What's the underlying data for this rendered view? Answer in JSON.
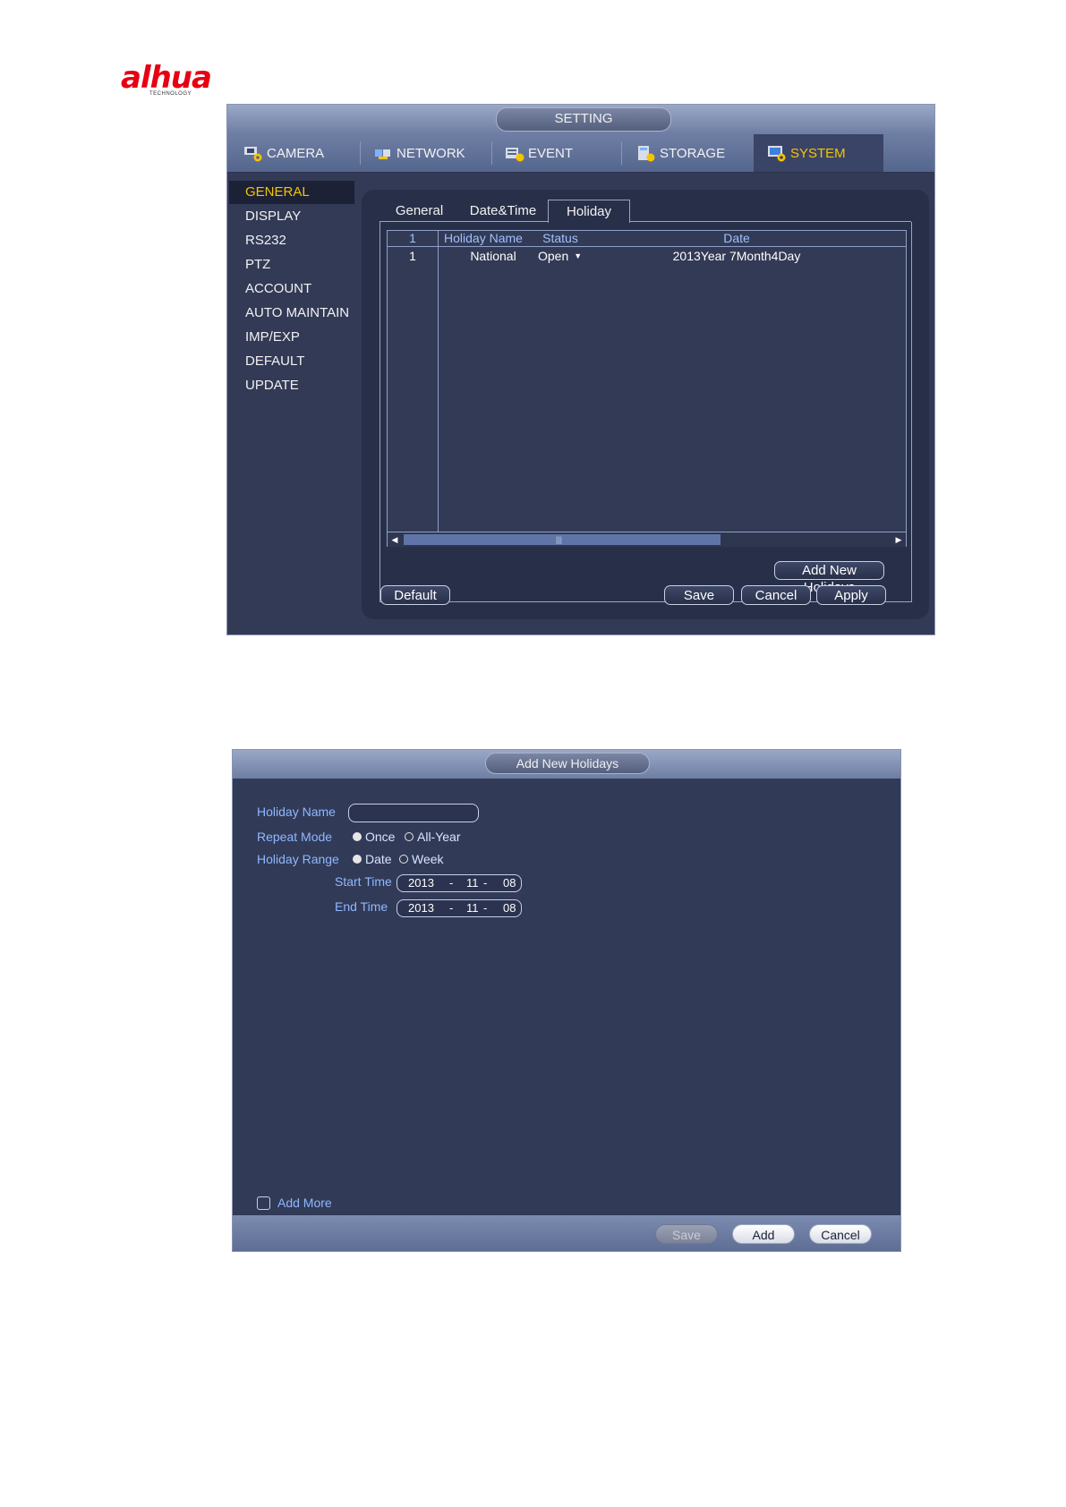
{
  "logo": {
    "text": "alhua",
    "subtext": "TECHNOLOGY"
  },
  "setting_window": {
    "title": "SETTING",
    "main_tabs": [
      {
        "label": "CAMERA",
        "icon": "camera-gear-icon"
      },
      {
        "label": "NETWORK",
        "icon": "network-icon"
      },
      {
        "label": "EVENT",
        "icon": "event-icon"
      },
      {
        "label": "STORAGE",
        "icon": "storage-icon"
      },
      {
        "label": "SYSTEM",
        "icon": "system-icon",
        "active": true
      }
    ],
    "sidebar": [
      {
        "label": "GENERAL",
        "active": true
      },
      {
        "label": "DISPLAY"
      },
      {
        "label": "RS232"
      },
      {
        "label": "PTZ"
      },
      {
        "label": "ACCOUNT"
      },
      {
        "label": "AUTO MAINTAIN"
      },
      {
        "label": "IMP/EXP"
      },
      {
        "label": "DEFAULT"
      },
      {
        "label": "UPDATE"
      }
    ],
    "sub_tabs": [
      {
        "label": "General"
      },
      {
        "label": "Date&Time"
      },
      {
        "label": "Holiday",
        "active": true
      }
    ],
    "table": {
      "headers": [
        "1",
        "Holiday Name",
        "Status",
        "Date"
      ],
      "rows": [
        {
          "index": "1",
          "name": "National",
          "status": "Open",
          "date": "2013Year 7Month4Day"
        }
      ]
    },
    "buttons": {
      "add_new_holidays": "Add New Holidays",
      "default": "Default",
      "save": "Save",
      "cancel": "Cancel",
      "apply": "Apply"
    },
    "colors": {
      "accent": "#f5c400",
      "header_text": "#9fc0ff",
      "background": "#323a55"
    }
  },
  "add_holiday_dialog": {
    "title": "Add New Holidays",
    "holiday_name_label": "Holiday Name",
    "holiday_name_value": "",
    "repeat_mode_label": "Repeat Mode",
    "repeat_options": [
      {
        "label": "Once",
        "selected": true
      },
      {
        "label": "All-Year",
        "selected": false
      }
    ],
    "holiday_range_label": "Holiday Range",
    "range_options": [
      {
        "label": "Date",
        "selected": true
      },
      {
        "label": "Week",
        "selected": false
      }
    ],
    "start_time_label": "Start Time",
    "start_time": {
      "year": "2013",
      "sep1": "-",
      "month": "11",
      "sep2": "-",
      "day": "08"
    },
    "end_time_label": "End Time",
    "end_time": {
      "year": "2013",
      "sep1": "-",
      "month": "11",
      "sep2": "-",
      "day": "08"
    },
    "add_more_label": "Add More",
    "add_more_checked": false,
    "buttons": {
      "save": "Save",
      "add": "Add",
      "cancel": "Cancel"
    },
    "colors": {
      "label": "#8fb8ff"
    }
  }
}
